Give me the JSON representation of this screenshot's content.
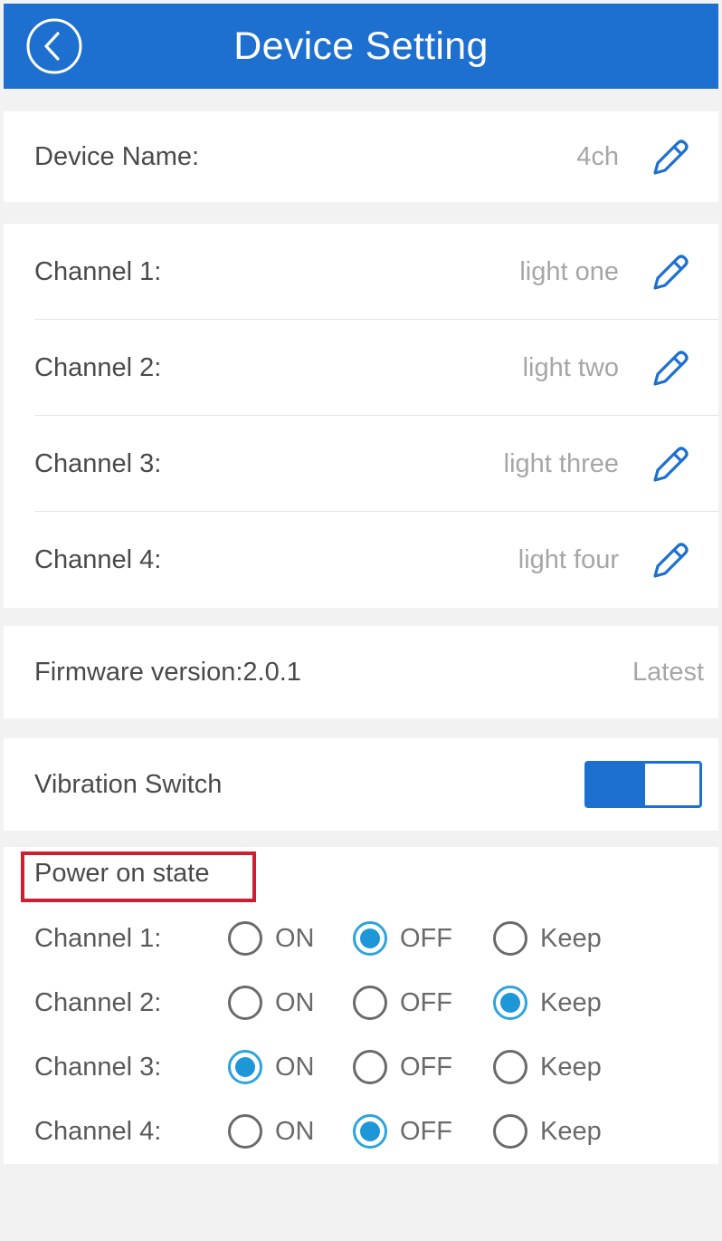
{
  "header": {
    "title": "Device Setting"
  },
  "device": {
    "label": "Device Name:",
    "value": "4ch"
  },
  "channels": [
    {
      "label": "Channel 1:",
      "value": "light one"
    },
    {
      "label": "Channel 2:",
      "value": "light two"
    },
    {
      "label": "Channel 3:",
      "value": "light three"
    },
    {
      "label": "Channel 4:",
      "value": "light four"
    }
  ],
  "firmware": {
    "label": "Firmware version:2.0.1",
    "status": "Latest"
  },
  "vibration": {
    "label": "Vibration Switch",
    "enabled": true
  },
  "power_on_state": {
    "title": "Power on state",
    "options": [
      "ON",
      "OFF",
      "Keep"
    ],
    "rows": [
      {
        "label": "Channel 1:",
        "selected": "OFF"
      },
      {
        "label": "Channel 2:",
        "selected": "Keep"
      },
      {
        "label": "Channel 3:",
        "selected": "ON"
      },
      {
        "label": "Channel 4:",
        "selected": "OFF"
      }
    ]
  },
  "colors": {
    "header_bg": "#1d6fd0",
    "accent": "#1e97d9",
    "highlight_box": "#d01e30"
  }
}
